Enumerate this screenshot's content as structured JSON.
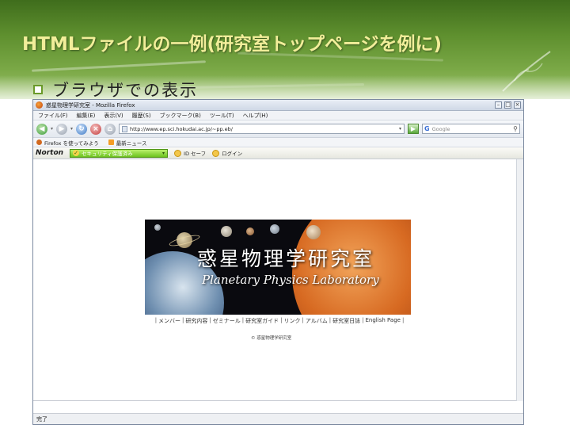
{
  "slide": {
    "title": "HTMLファイルの一例(研究室トップページを例に)",
    "bullet": "ブラウザでの表示"
  },
  "browser": {
    "window_title": "惑星物理学研究室 - Mozilla Firefox",
    "window_buttons": [
      "–",
      "□",
      "×"
    ],
    "menu": [
      "ファイル(F)",
      "編集(E)",
      "表示(V)",
      "履歴(S)",
      "ブックマーク(B)",
      "ツール(T)",
      "ヘルプ(H)"
    ],
    "url": "http://www.ep.sci.hokudai.ac.jp/~pp.eb/",
    "search_placeholder": "Google",
    "bookmarks": [
      "Firefox を使ってみよう",
      "最新ニュース"
    ],
    "norton": {
      "logo": "Norton",
      "safe_label": "セキュリティ保護済み",
      "item1": "ID セーフ",
      "item2": "ログイン"
    },
    "status": "完了"
  },
  "page": {
    "banner_title": "惑星物理学研究室",
    "banner_subtitle": "Planetary Physics Laboratory",
    "nav_links": [
      "メンバー",
      "研究内容",
      "ゼミナール",
      "研究室ガイド",
      "リンク",
      "アルバム",
      "研究室日誌",
      "English Page"
    ],
    "copyright": "© 惑星物理学研究室"
  },
  "colors": {
    "header_green": "#5e8f2e",
    "title_text": "#f2ee9a",
    "bullet_marker": "#6a9a2a"
  }
}
